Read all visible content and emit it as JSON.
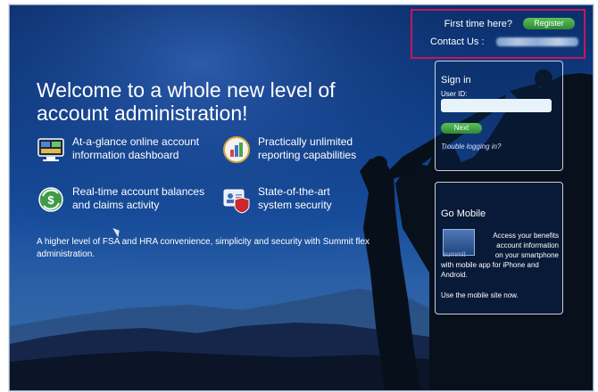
{
  "header": {
    "first_time": "First time here?",
    "register_label": "Register",
    "contact_label": "Contact Us :"
  },
  "hero": {
    "headline_line1": "Welcome to a whole new level of",
    "headline_line2": "account administration!",
    "features": [
      {
        "line1": "At-a-glance online account",
        "line2": "information dashboard",
        "icon": "dashboard-monitor-icon"
      },
      {
        "line1": "Practically unlimited",
        "line2": "reporting capabilities",
        "icon": "bar-chart-icon"
      },
      {
        "line1": "Real-time account balances",
        "line2": "and claims activity",
        "icon": "dollar-refresh-icon"
      },
      {
        "line1": "State-of-the-art",
        "line2": "system security",
        "icon": "shield-id-card-icon"
      }
    ],
    "description": "A higher level of FSA and HRA convenience, simplicity and security with Summit flex administration."
  },
  "signin": {
    "title": "Sign in",
    "user_id_label": "User ID:",
    "user_id_value": "",
    "next_label": "Next",
    "trouble_label": "Trouble logging in?"
  },
  "mobile": {
    "title": "Go Mobile",
    "promo_line1": "Access your benefits",
    "promo_line2": "account information",
    "promo_line3": "on your smartphone",
    "promo_line4": "with mobile app for iPhone and",
    "promo_line5": "Android.",
    "summit_word": "summit",
    "link": "Use the mobile site now."
  },
  "colors": {
    "accent_green": "#3a9b3f",
    "highlight_border": "#c2185b",
    "background_blue": "#0f3d86"
  }
}
